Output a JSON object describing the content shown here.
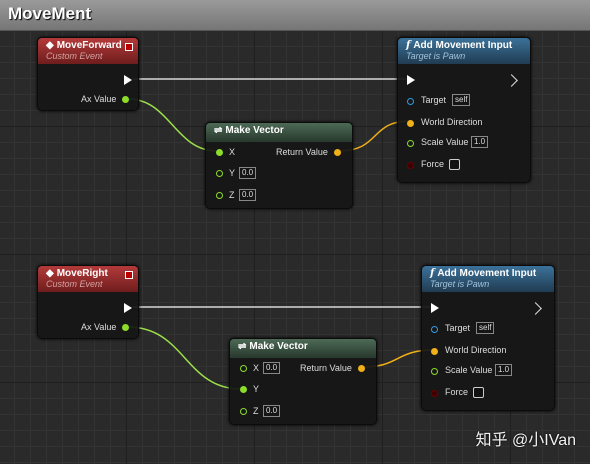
{
  "comment_title": "MoveMent",
  "graph1": {
    "event": {
      "title": "MoveForward",
      "subtitle": "Custom Event",
      "pin_label": "Ax Value"
    },
    "make_vector": {
      "title": "Make Vector",
      "x_label": "X",
      "y_label": "Y",
      "y_value": "0.0",
      "z_label": "Z",
      "z_value": "0.0",
      "return_label": "Return Value"
    },
    "add_input": {
      "title": "Add Movement Input",
      "subtitle": "Target is Pawn",
      "target_label": "Target",
      "target_value": "self",
      "world_label": "World Direction",
      "scale_label": "Scale Value",
      "scale_value": "1.0",
      "force_label": "Force"
    }
  },
  "graph2": {
    "event": {
      "title": "MoveRight",
      "subtitle": "Custom Event",
      "pin_label": "Ax Value"
    },
    "make_vector": {
      "title": "Make Vector",
      "x_label": "X",
      "x_value": "0.0",
      "y_label": "Y",
      "z_label": "Z",
      "z_value": "0.0",
      "return_label": "Return Value"
    },
    "add_input": {
      "title": "Add Movement Input",
      "subtitle": "Target is Pawn",
      "target_label": "Target",
      "target_value": "self",
      "world_label": "World Direction",
      "scale_label": "Scale Value",
      "scale_value": "1.0",
      "force_label": "Force"
    }
  },
  "watermark": "知乎 @小IVan",
  "colors": {
    "exec": "#ffffff",
    "float": "#8cdc2a",
    "vector": "#f0b018",
    "object": "#2f9ce5",
    "bool": "#6b0000"
  }
}
